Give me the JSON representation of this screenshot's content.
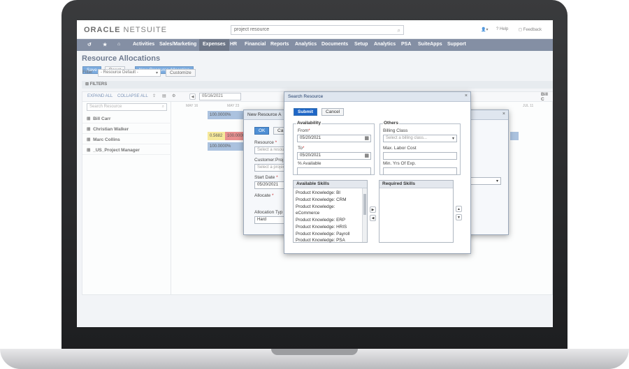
{
  "app": {
    "logo_brand": "ORACLE",
    "logo_product": "NETSUITE",
    "search_value": "project resource",
    "util_help": "Help",
    "util_feedback": "Feedback"
  },
  "nav": {
    "items": [
      "Activities",
      "Sales/Marketing",
      "Expenses",
      "HR",
      "Financial",
      "Reports",
      "Analytics",
      "Documents",
      "Setup",
      "Analytics",
      "PSA",
      "SuiteApps",
      "Support"
    ],
    "selected": "Expenses"
  },
  "page": {
    "title": "Resource Allocations",
    "save": "Save",
    "reset": "Reset",
    "new_allocation": "New Resource Allocation",
    "filter_label": "Filter",
    "filter_value": "- Resource Default -",
    "customize": "Customize",
    "filters_bar": "FILTERS",
    "expand_all": "EXPAND ALL",
    "collapse_all": "COLLAPSE ALL",
    "date_value": "05/16/2021",
    "search_resource_placeholder": "Search Resource",
    "date_headers": [
      "MAY 16",
      "MAY 23",
      "JUL 11"
    ],
    "right_label": "Bill C"
  },
  "resources": [
    {
      "name": "Bill Carr",
      "bar": "100.0000%"
    },
    {
      "name": "Christian Walker",
      "bar": ""
    },
    {
      "name": "Marc Collins",
      "bar": "0.5682",
      "bar2": "100.0000"
    },
    {
      "name": "_US_Project Manager",
      "bar": "100.0000%"
    }
  ],
  "new_alloc_dialog": {
    "title": "New Resource A",
    "ok": "OK",
    "cancel_partial": "Ca",
    "resource_label": "Resource",
    "resource_placeholder": "Select a resour",
    "customer_label": "Customer:Proj",
    "customer_placeholder": "Select a project",
    "start_label": "Start Date",
    "start_value": "05/20/2021",
    "allocate_label": "Allocate",
    "alloc_type_label": "Allocation Typ",
    "alloc_type_value": "Hard"
  },
  "search_dialog": {
    "title": "Search Resource",
    "submit": "Submit",
    "cancel": "Cancel",
    "availability_title": "Availability",
    "from_label": "From",
    "from_value": "05/20/2021",
    "to_label": "To",
    "to_value": "05/20/2021",
    "pct_label": "% Available",
    "others_title": "Others",
    "billing_label": "Billing Class",
    "billing_placeholder": "Select a billing class...",
    "max_cost_label": "Max. Labor Cost",
    "min_yrs_label": "Min. Yrs Of Exp.",
    "available_skills_title": "Available Skills",
    "required_skills_title": "Required Skills",
    "skills": [
      "Product Knowledge: BI",
      "Product Knowledge: CRM",
      "Product Knowledge:",
      "eCommerce",
      "Product Knowledge: ERP",
      "Product Knowledge: HRIS",
      "Product Knowledge: Payroll",
      "Product Knowledge: PSA"
    ]
  },
  "colors": {
    "nav_bg": "#5b6a86",
    "primary_button": "#4f8fd5",
    "submit_button": "#1e66c7",
    "bar_blue": "#8faed4",
    "bar_yellow": "#f3e27a",
    "bar_red": "#e06b6b"
  }
}
